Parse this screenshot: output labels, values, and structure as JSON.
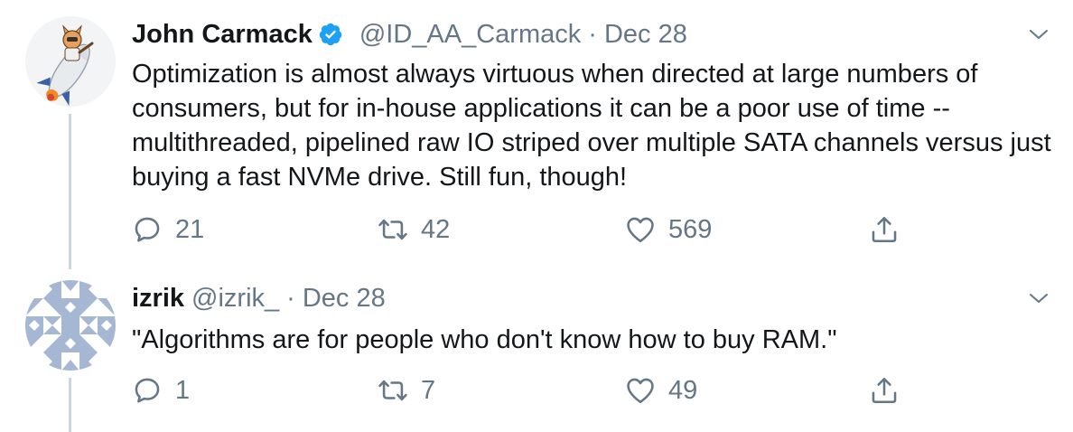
{
  "tweets": [
    {
      "name": "John Carmack",
      "handle": "@ID_AA_Carmack",
      "separator": "·",
      "date": "Dec 28",
      "verified": true,
      "text": "Optimization is almost always virtuous when directed at large numbers of consumers, but for in-house applications it can be a poor use of time -- multithreaded, pipelined raw IO striped over multiple SATA channels versus just buying a fast NVMe drive.  Still fun, though!",
      "replies": "21",
      "retweets": "42",
      "likes": "569",
      "avatar_icon": "rocket-cat-avatar"
    },
    {
      "name": "izrik",
      "handle": "@izrik_",
      "separator": "·",
      "date": "Dec 28",
      "verified": false,
      "text": "\"Algorithms are for people who don't know how to buy RAM.\"",
      "replies": "1",
      "retweets": "7",
      "likes": "49",
      "avatar_icon": "identicon-avatar"
    }
  ],
  "colors": {
    "text": "#14171a",
    "secondary": "#657786",
    "verified": "#1da1f2",
    "thread_line": "#ccd6dd",
    "identicon": "#a6b7d4"
  }
}
